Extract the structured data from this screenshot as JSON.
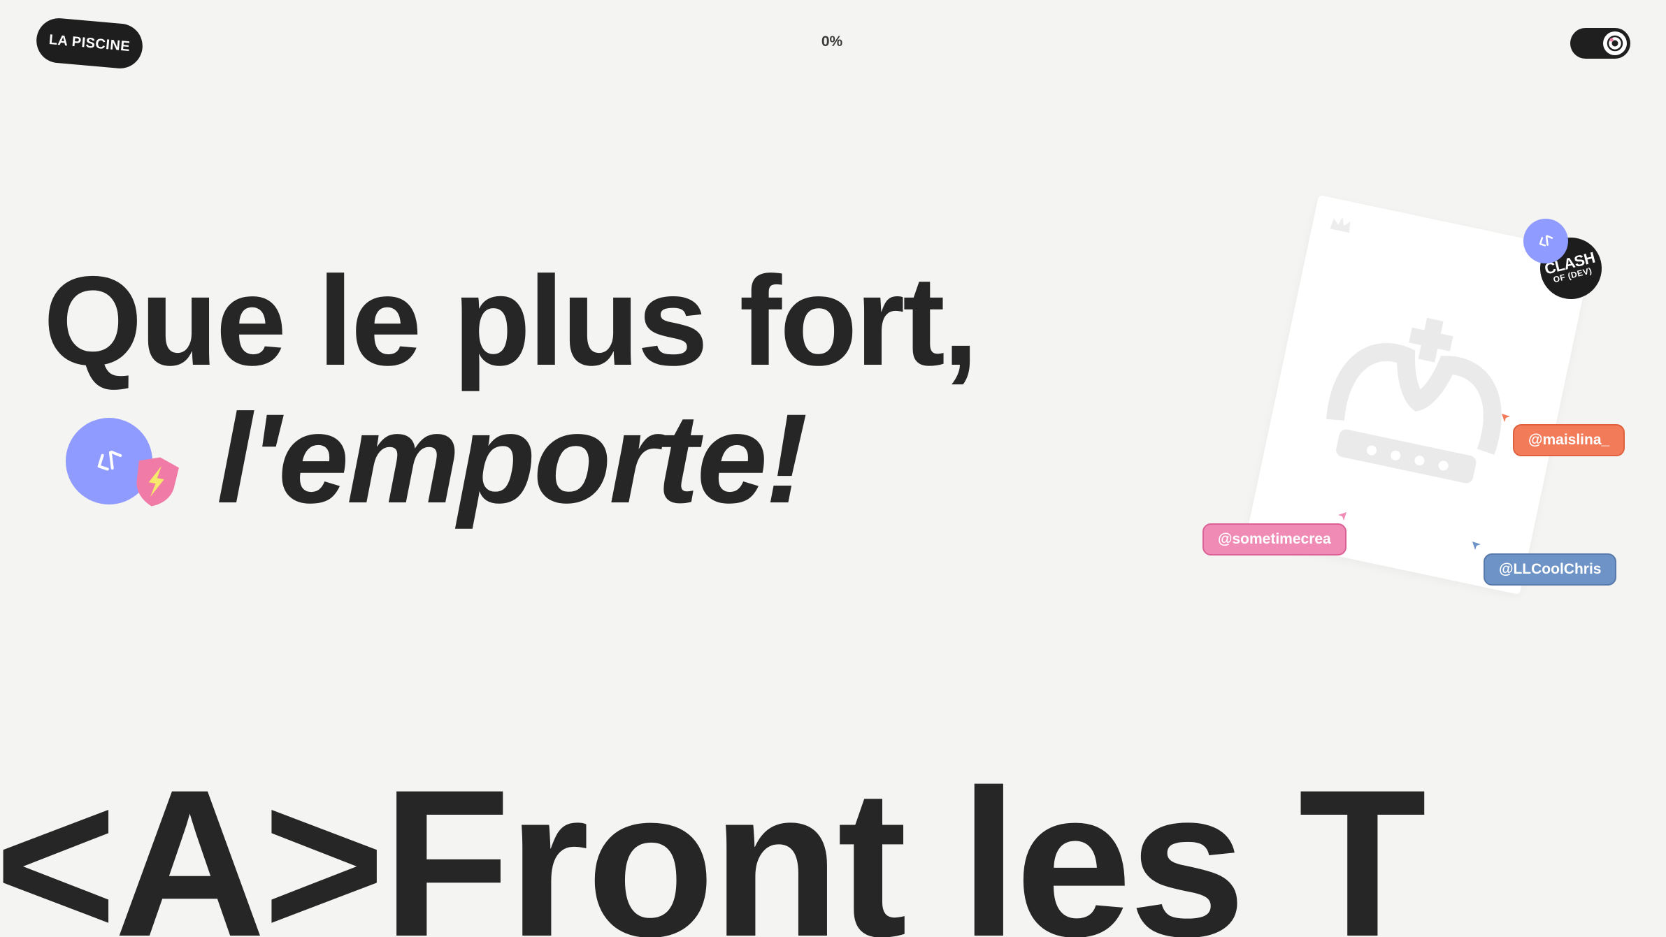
{
  "header": {
    "logo_text": "LA PISCINE",
    "progress": "0%"
  },
  "hero": {
    "line1": "Que le plus fort,",
    "line2": "l'emporte!"
  },
  "card": {
    "clash_line1": "CLASH",
    "clash_line2": "OF (DEV)"
  },
  "cursors": [
    {
      "handle": "@maislina_",
      "color": "#f27c5a"
    },
    {
      "handle": "@sometimecrea",
      "color": "#f08bb5"
    },
    {
      "handle": "@LLCoolChris",
      "color": "#6d93c7"
    }
  ],
  "marquee": {
    "text": "<A>Front les T"
  },
  "colors": {
    "background": "#f4f4f2",
    "text": "#262626",
    "accent_purple": "#8f9bff",
    "accent_pink": "#f07ba6"
  },
  "icons": {
    "code": "code-icon",
    "shield": "shield-bolt-icon",
    "crown": "crown-icon",
    "theme": "theme-toggle-icon"
  }
}
